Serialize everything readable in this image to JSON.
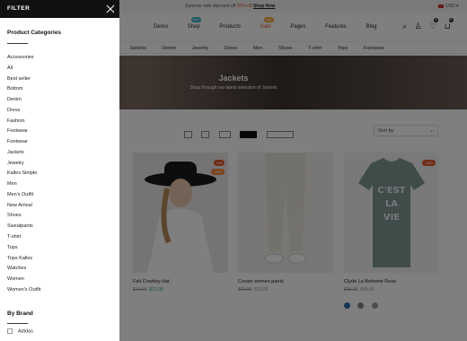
{
  "topbar": {
    "promo_prefix": "Summer sale discount off ",
    "promo_sale": "50% off",
    "promo_link": "Shop Now",
    "currency": "USD"
  },
  "nav": {
    "items": [
      {
        "label": "Demo"
      },
      {
        "label": "Shop",
        "badge": "New"
      },
      {
        "label": "Products"
      },
      {
        "label": "Sale",
        "badge": "Sale"
      },
      {
        "label": "Pages"
      },
      {
        "label": "Features"
      },
      {
        "label": "Blog"
      }
    ],
    "wishlist_count": "0",
    "cart_count": "0"
  },
  "catbar": [
    "Jackets",
    "Denim",
    "Jewelry",
    "Dress",
    "Men",
    "Shoes",
    "T-shirt",
    "Tops",
    "Footwear"
  ],
  "hero": {
    "title": "Jackets",
    "subtitle": "Shop through our latest selection of Jackets"
  },
  "toolbar": {
    "sort_label": "Sort by"
  },
  "products": [
    {
      "name": "Felt Cowboy Hat",
      "old_price": "$15.00",
      "price": "$12.00",
      "tags": [
        "Hot",
        "-20%"
      ]
    },
    {
      "name": "Cream women pants",
      "old_price": "$25.00",
      "price": "$30.00",
      "tags": []
    },
    {
      "name": "Clyde La Boheme Rose",
      "old_price": "$25.00",
      "price": "$45.00",
      "tags": [
        "-34%"
      ],
      "swatches": [
        "#2d6db0",
        "#7d8a86",
        "#9a9a9a"
      ],
      "shirt_text": "C'EST LA VIE"
    }
  ],
  "filter": {
    "title": "FILTER",
    "categories_title": "Product Categories",
    "categories": [
      "Accessories",
      "All",
      "Best seller",
      "Bottom",
      "Denim",
      "Dress",
      "Fashion",
      "Footwear",
      "Footwear",
      "Jackets",
      "Jewelry",
      "Kalles Simple",
      "Men",
      "Men's Outfit",
      "New Arrival",
      "Shoes",
      "Sweatpants",
      "T-shirt",
      "Tops",
      "Tops Kalles",
      "Watches",
      "Women",
      "Women's Outfit"
    ],
    "brand_title": "By Brand",
    "brands": [
      "Adidas"
    ]
  }
}
